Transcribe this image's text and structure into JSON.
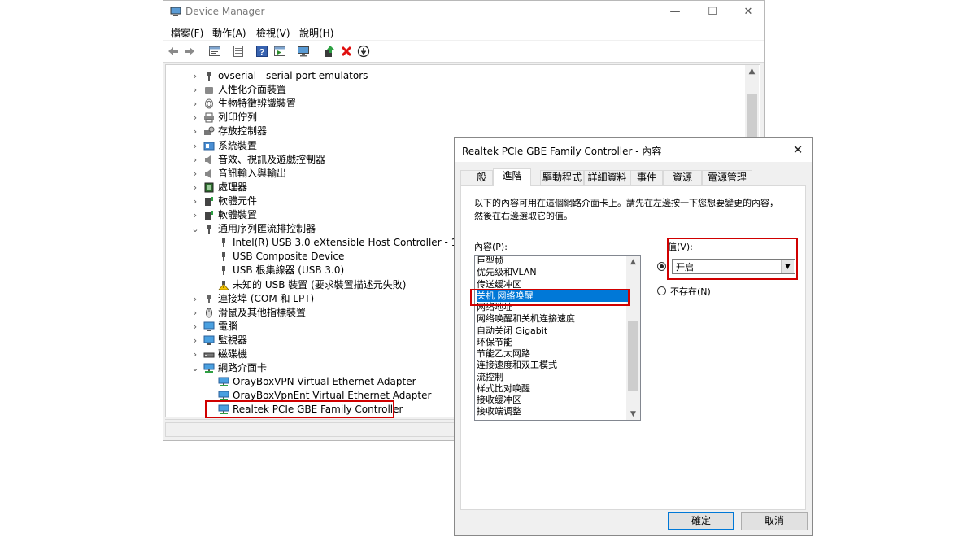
{
  "device_manager": {
    "title": "Device Manager",
    "window_controls": {
      "minimize": "—",
      "maximize": "☐",
      "close": "✕"
    },
    "menu": [
      "檔案(F)",
      "動作(A)",
      "檢視(V)",
      "說明(H)"
    ],
    "toolbar_icons": [
      "back-icon",
      "forward-icon",
      "properties-icon",
      "refresh-icon",
      "help-icon",
      "view-icon",
      "monitor-icon",
      "update-driver-icon",
      "uninstall-icon",
      "disable-icon"
    ],
    "tree": [
      {
        "label": "ovserial - serial port emulators",
        "expander": "›",
        "icon": "usb-icon"
      },
      {
        "label": "人性化介面裝置",
        "expander": "›",
        "icon": "hid-icon"
      },
      {
        "label": "生物特徵辨識裝置",
        "expander": "›",
        "icon": "fingerprint-icon"
      },
      {
        "label": "列印佇列",
        "expander": "›",
        "icon": "printer-icon"
      },
      {
        "label": "存放控制器",
        "expander": "›",
        "icon": "storage-icon"
      },
      {
        "label": "系統裝置",
        "expander": "›",
        "icon": "system-icon"
      },
      {
        "label": "音效、視訊及遊戲控制器",
        "expander": "›",
        "icon": "speaker-icon"
      },
      {
        "label": "音訊輸入與輸出",
        "expander": "›",
        "icon": "speaker-icon"
      },
      {
        "label": "處理器",
        "expander": "›",
        "icon": "cpu-icon"
      },
      {
        "label": "軟體元件",
        "expander": "›",
        "icon": "component-icon"
      },
      {
        "label": "軟體裝置",
        "expander": "›",
        "icon": "component-icon"
      },
      {
        "label": "通用序列匯流排控制器",
        "expander": "⌄",
        "icon": "usb-icon"
      },
      {
        "label": "Intel(R) USB 3.0 eXtensible Host Controller - 1.0 (Mic",
        "expander": "",
        "icon": "usb-icon"
      },
      {
        "label": "USB Composite Device",
        "expander": "",
        "icon": "usb-icon"
      },
      {
        "label": "USB 根集線器 (USB 3.0)",
        "expander": "",
        "icon": "usb-icon"
      },
      {
        "label": "未知的 USB 裝置 (要求裝置描述元失敗)",
        "expander": "",
        "icon": "warning-usb-icon"
      },
      {
        "label": "連接埠 (COM 和 LPT)",
        "expander": "›",
        "icon": "port-icon"
      },
      {
        "label": "滑鼠及其他指標裝置",
        "expander": "›",
        "icon": "mouse-icon"
      },
      {
        "label": "電腦",
        "expander": "›",
        "icon": "computer-icon"
      },
      {
        "label": "監視器",
        "expander": "›",
        "icon": "monitor-icon"
      },
      {
        "label": "磁碟機",
        "expander": "›",
        "icon": "disk-icon"
      },
      {
        "label": "網路介面卡",
        "expander": "⌄",
        "icon": "network-icon"
      },
      {
        "label": "OrayBoxVPN Virtual Ethernet Adapter",
        "expander": "",
        "icon": "network-adapter-icon"
      },
      {
        "label": "OrayBoxVpnEnt Virtual Ethernet Adapter",
        "expander": "",
        "icon": "network-adapter-icon"
      },
      {
        "label": "Realtek PCIe GBE Family Controller",
        "expander": "",
        "icon": "network-adapter-icon"
      }
    ]
  },
  "dialog": {
    "title": "Realtek PCIe GBE Family Controller - 內容",
    "close": "✕",
    "tabs": [
      "一般",
      "進階",
      "驅動程式",
      "詳細資料",
      "事件",
      "資源",
      "電源管理"
    ],
    "active_tab": "進階",
    "description": "以下的內容可用在這個網路介面卡上。請先在左邊按一下您想要變更的內容，然後在右邊選取它的值。",
    "property_label": "內容(P):",
    "properties": [
      "巨型帧",
      "优先级和VLAN",
      "传送缓冲区",
      "关机 网络唤醒",
      "网络地址",
      "网络唤醒和关机连接速度",
      "自动关闭 Gigabit",
      "环保节能",
      "节能乙太网路",
      "连接速度和双工模式",
      "流控制",
      "样式比对唤醒",
      "接收缓冲区",
      "接收端调整"
    ],
    "selected_property": "关机 网络唤醒",
    "value_label": "值(V):",
    "value": "开启",
    "not_present_label": "不存在(N)",
    "ok": "確定",
    "cancel": "取消"
  },
  "colors": {
    "highlight_border": "#d00000",
    "selection": "#0078d7"
  }
}
